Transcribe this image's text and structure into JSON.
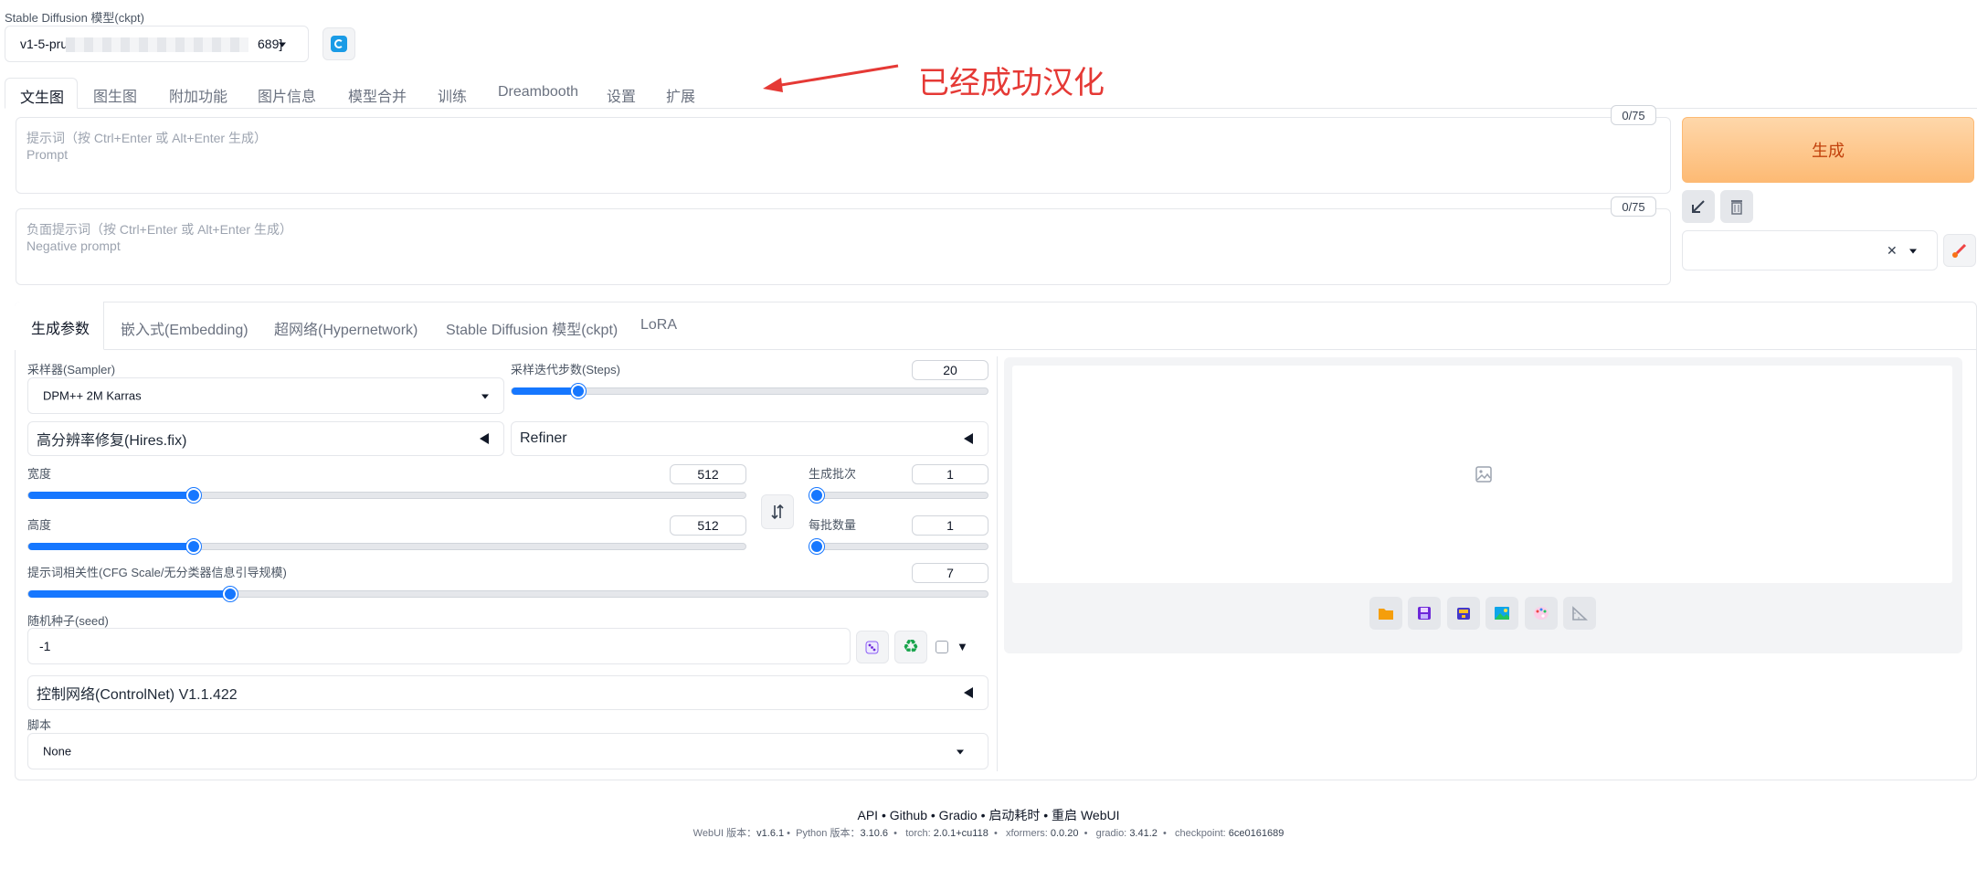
{
  "model": {
    "label": "Stable Diffusion 模型(ckpt)",
    "selected": "v1-5-pru",
    "selected_suffix": "689]"
  },
  "annotation": {
    "text": "已经成功汉化",
    "color": "#e53935"
  },
  "main_tabs": [
    "文生图",
    "图生图",
    "附加功能",
    "图片信息",
    "模型合并",
    "训练",
    "Dreambooth",
    "设置",
    "扩展"
  ],
  "prompt": {
    "counter": "0/75",
    "placeholder_line1": "提示词（按 Ctrl+Enter 或 Alt+Enter 生成）",
    "placeholder_line2": "Prompt"
  },
  "negative_prompt": {
    "counter": "0/75",
    "placeholder_line1": "负面提示词（按 Ctrl+Enter 或 Alt+Enter 生成）",
    "placeholder_line2": "Negative prompt"
  },
  "generate": {
    "label": "生成",
    "color": "#fdba74"
  },
  "sub_tabs": [
    "生成参数",
    "嵌入式(Embedding)",
    "超网络(Hypernetwork)",
    "Stable Diffusion 模型(ckpt)",
    "LoRA"
  ],
  "sampler": {
    "label": "采样器(Sampler)",
    "value": "DPM++ 2M Karras"
  },
  "steps": {
    "label": "采样迭代步数(Steps)",
    "value": "20",
    "fraction": 0.14
  },
  "hires": {
    "label": "高分辨率修复(Hires.fix)"
  },
  "refiner": {
    "label": "Refiner"
  },
  "width": {
    "label": "宽度",
    "value": "512",
    "fraction": 0.23
  },
  "height": {
    "label": "高度",
    "value": "512",
    "fraction": 0.23
  },
  "batch_count": {
    "label": "生成批次",
    "value": "1",
    "fraction": 0
  },
  "batch_size": {
    "label": "每批数量",
    "value": "1",
    "fraction": 0
  },
  "cfg": {
    "label": "提示词相关性(CFG Scale/无分类器信息引导规模)",
    "value": "7",
    "fraction": 0.21
  },
  "seed": {
    "label": "随机种子(seed)",
    "value": "-1"
  },
  "controlnet": {
    "label": "控制网络(ControlNet) V1.1.422"
  },
  "script": {
    "label": "脚本",
    "value": "None"
  },
  "footer": {
    "links": "API  •  Github  •  Gradio  •  启动耗时  •  重启 WebUI",
    "webui_label": "WebUI 版本：",
    "webui_version": "v1.6.1",
    "python_label": "Python 版本：",
    "python_version": "3.10.6",
    "torch_label": "torch:",
    "torch_version": "2.0.1+cu118",
    "xformers_label": "xformers:",
    "xformers_version": "0.0.20",
    "gradio_label": "gradio:",
    "gradio_version": "3.41.2",
    "checkpoint_label": "checkpoint:",
    "checkpoint_version": "6ce0161689"
  },
  "icons": {
    "refresh": "refresh-icon",
    "swap": "swap-icon",
    "dice": "dice-icon",
    "recycle": "recycle-icon",
    "folder": "folder-icon",
    "save": "save-icon",
    "zip": "zip-icon",
    "image": "image-icon",
    "palette": "palette-icon",
    "ruler": "ruler-icon",
    "paint": "paint-icon",
    "trash": "trash-icon",
    "arrow_in": "arrow-in-icon",
    "placeholder_image": "image-placeholder-icon"
  }
}
